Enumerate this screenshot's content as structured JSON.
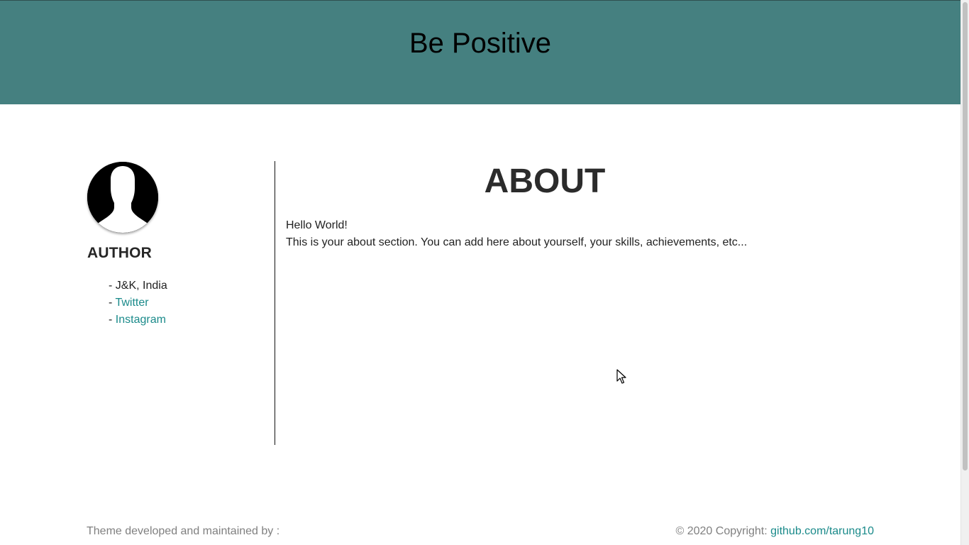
{
  "header": {
    "title": "Be Positive"
  },
  "sidebar": {
    "author_heading": "AUTHOR",
    "items": [
      {
        "prefix": "- ",
        "label": "J&K, India",
        "is_link": false
      },
      {
        "prefix": "- ",
        "label": "Twitter",
        "is_link": true
      },
      {
        "prefix": "- ",
        "label": "Instagram",
        "is_link": true
      }
    ]
  },
  "main": {
    "title": "ABOUT",
    "line1": "Hello World!",
    "line2": "This is your about section. You can add here about yourself, your skills, achievements, etc..."
  },
  "footer": {
    "left_text": "Theme developed and maintained by :",
    "copyright_text": "© 2020 Copyright: ",
    "copyright_link": "github.com/tarung10"
  },
  "colors": {
    "header_bg": "#458080",
    "link": "#1a8a8a",
    "footer_text": "#808080"
  },
  "icons": {
    "avatar": "person-silhouette-icon",
    "cursor": "mouse-pointer-icon"
  }
}
